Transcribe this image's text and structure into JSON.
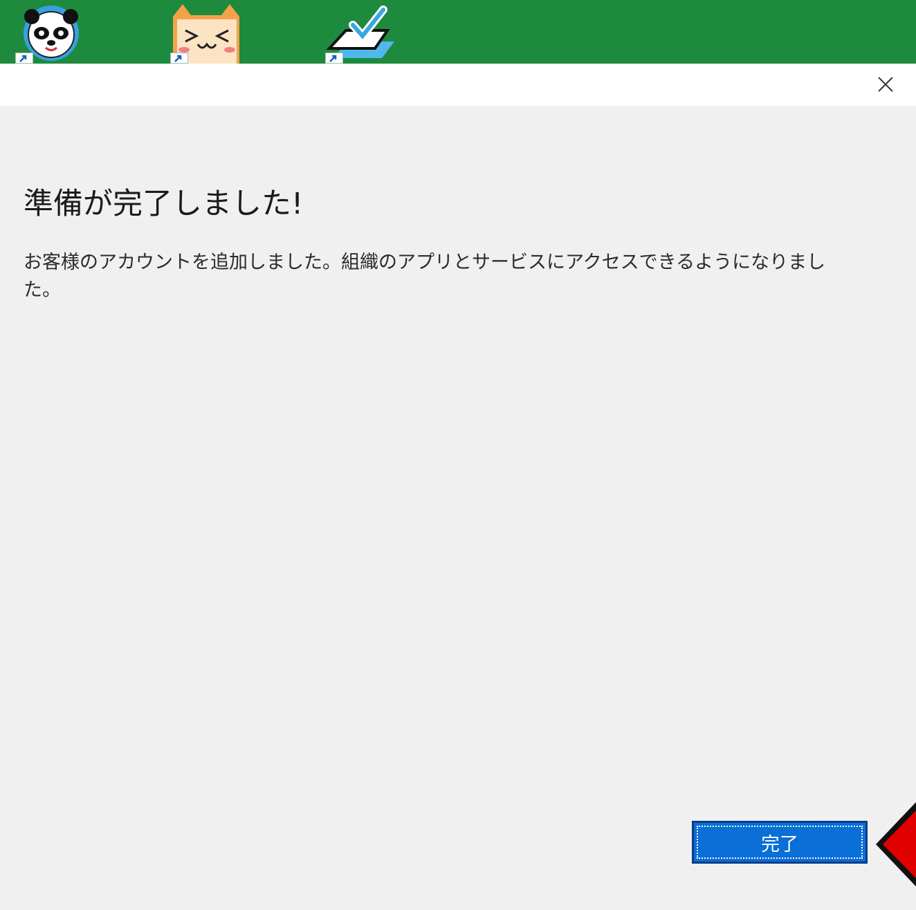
{
  "desktop": {
    "icons": [
      {
        "name": "panda-app-icon"
      },
      {
        "name": "cat-app-icon"
      },
      {
        "name": "checkmark-app-icon"
      }
    ],
    "background_color": "#1e8a3e"
  },
  "dialog": {
    "close_icon": "close-icon",
    "heading": "準備が完了しました!",
    "message": "お客様のアカウントを追加しました。組織のアプリとサービスにアクセスできるようになりました。",
    "done_button_label": "完了",
    "accent_color": "#0a6fd6"
  },
  "annotation": {
    "arrow_color": "#e00000"
  }
}
